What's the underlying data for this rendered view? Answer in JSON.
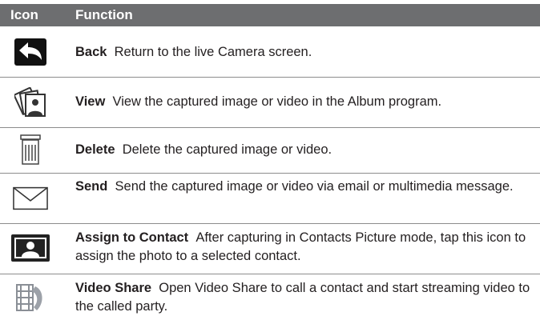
{
  "header": {
    "icon_col": "Icon",
    "function_col": "Function"
  },
  "rows": [
    {
      "icon": "back-arrow-icon",
      "name": "Back",
      "desc": "Return to the live Camera screen."
    },
    {
      "icon": "view-album-icon",
      "name": "View",
      "desc": "View the captured image or video in the Album program."
    },
    {
      "icon": "trash-bin-icon",
      "name": "Delete",
      "desc": "Delete the captured image or video."
    },
    {
      "icon": "envelope-icon",
      "name": "Send",
      "desc": "Send the captured image or video via email or multimedia message."
    },
    {
      "icon": "contact-picture-icon",
      "name": "Assign to Contact",
      "desc": "After capturing in Contacts Picture mode, tap this icon to assign the photo to a selected contact."
    },
    {
      "icon": "video-share-icon",
      "name": "Video Share",
      "desc": "Open Video Share to call a contact and start streaming video to the called party."
    }
  ],
  "colors": {
    "header_bg": "#6d6e70",
    "header_text": "#ffffff",
    "rule": "#8c8c8c"
  }
}
